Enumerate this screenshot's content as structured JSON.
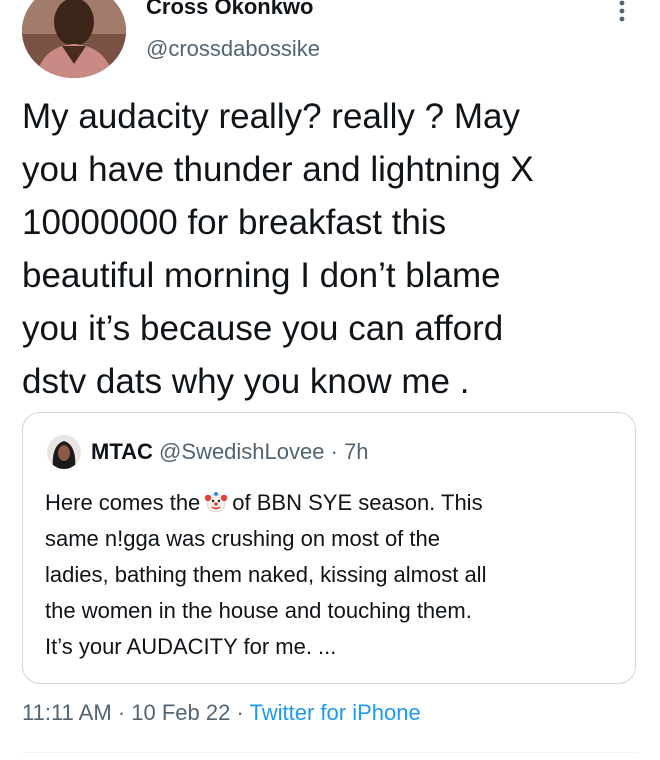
{
  "author": {
    "display_name": "Cross Okonkwo",
    "handle": "@crossdabossike"
  },
  "tweet": {
    "lines": [
      "My audacity really? really ? May",
      "you have thunder and lightning X",
      "10000000 for breakfast this",
      "beautiful morning I don’t blame",
      "you it’s because you can afford",
      "dstv dats why you know me ."
    ]
  },
  "quote": {
    "display_name": "MTAC",
    "handle": "@SwedishLovee",
    "separator": "·",
    "time": "7h",
    "line1_before": "Here comes the",
    "line1_after": "of BBN SYE season. This",
    "lines": [
      "same n!gga was crushing on most of the",
      "ladies, bathing them naked, kissing almost all",
      "the women in the house and touching them.",
      "It’s your AUDACITY for me. ..."
    ]
  },
  "meta": {
    "time": "11:11 AM",
    "sep1": "·",
    "date": "10 Feb 22",
    "sep2": "·",
    "source": "Twitter for iPhone"
  },
  "icons": {
    "more": "more-vertical-icon",
    "clown": "clown-face-icon"
  },
  "colors": {
    "text": "#0f1419",
    "secondary": "#536471",
    "link": "#1d9bf0",
    "border": "#cfd9de"
  }
}
